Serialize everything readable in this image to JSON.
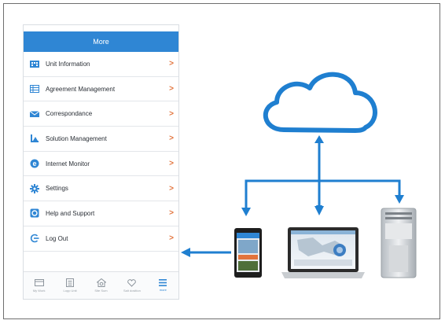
{
  "phone": {
    "title": "More",
    "menu_items": [
      {
        "label": "Unit Information",
        "icon": "building-icon"
      },
      {
        "label": "Agreement Management",
        "icon": "table-icon"
      },
      {
        "label": "Correspondance",
        "icon": "envelope-icon"
      },
      {
        "label": "Solution Management",
        "icon": "chart-icon"
      },
      {
        "label": "Internet Monitor",
        "icon": "browser-e-icon"
      },
      {
        "label": "Settings",
        "icon": "gear-icon"
      },
      {
        "label": "Help and Support",
        "icon": "help-icon"
      },
      {
        "label": "Log Out",
        "icon": "logout-icon"
      }
    ],
    "tabs": [
      {
        "label": "My Work",
        "icon": "monitor-icon"
      },
      {
        "label": "Lopp Unit",
        "icon": "clipboard-icon"
      },
      {
        "label": "Site Sum",
        "icon": "house-gear-icon"
      },
      {
        "label": "Salt dosition",
        "icon": "heart-icon"
      },
      {
        "label": "more",
        "icon": "hamburger-icon"
      }
    ],
    "active_tab": 4
  },
  "colors": {
    "header": "#2f86d4",
    "accent_blue": "#1f7fd0",
    "chevron": "#e2733b"
  }
}
